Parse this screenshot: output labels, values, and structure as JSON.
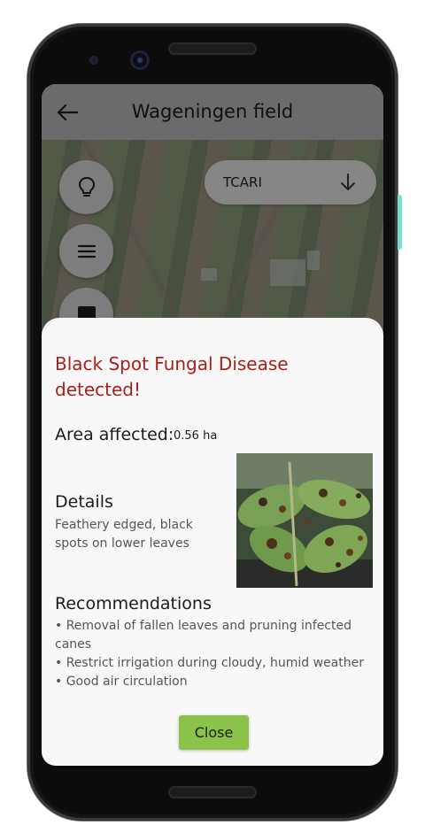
{
  "appbar": {
    "title": "Wageningen field",
    "back_icon": "arrow-left-icon"
  },
  "map": {
    "buttons": [
      {
        "icon": "lightbulb-icon"
      },
      {
        "icon": "menu-icon"
      },
      {
        "icon": "square-icon"
      }
    ],
    "index_dropdown": {
      "label": "TCARI",
      "icon": "arrow-down-icon"
    }
  },
  "sheet": {
    "alert": "Black Spot Fungal Disease detected!",
    "alert_color": "#a8201a",
    "area_label": "Area affected:",
    "area_value": "0.56 ha",
    "details_heading": "Details",
    "details_text": "Feathery edged, black spots on lower leaves",
    "image_description": "leaf-with-black-spots-photo",
    "recommendations_heading": "Recommendations",
    "recommendations": [
      "• Removal of fallen leaves and pruning infected canes",
      "• Restrict irrigation during cloudy, humid weather",
      "• Good air circulation"
    ],
    "close_label": "Close",
    "close_color": "#8bc34a"
  }
}
